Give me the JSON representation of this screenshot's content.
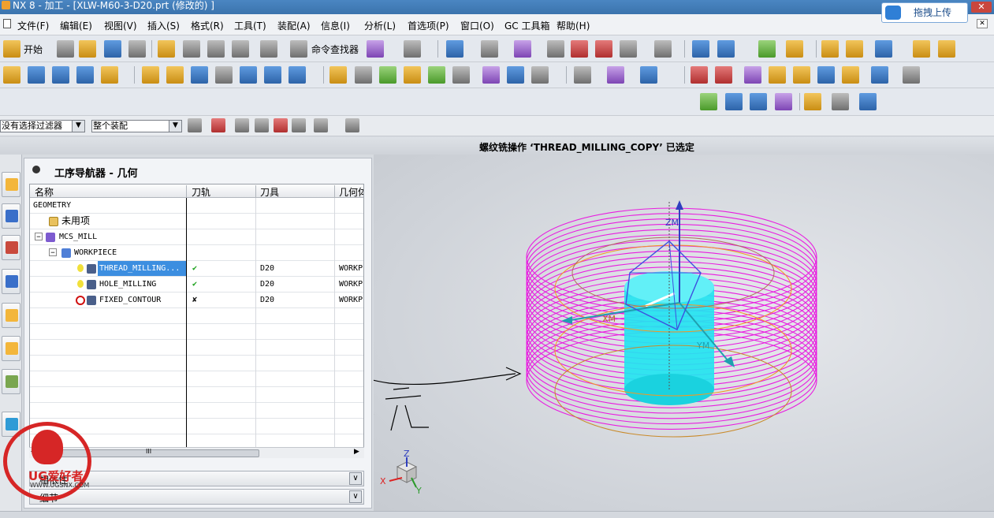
{
  "window": {
    "title": "NX 8 - 加工 - [XLW-M60-3-D20.prt (修改的) ]",
    "upload_button": "拖拽上传",
    "close_glyph": "✕"
  },
  "menubar": {
    "items": [
      "文件(F)",
      "编辑(E)",
      "视图(V)",
      "插入(S)",
      "格式(R)",
      "工具(T)",
      "装配(A)",
      "信息(I)",
      "分析(L)",
      "首选项(P)",
      "窗口(O)",
      "GC 工具箱",
      "帮助(H)"
    ]
  },
  "toolbar": {
    "start_label": "开始",
    "command_finder_label": "命令查找器"
  },
  "filters": {
    "selection_filter": "没有选择过滤器",
    "assembly_scope": "整个装配"
  },
  "status": {
    "message": "螺纹铣操作 ‘THREAD_MILLING_COPY’ 已选定"
  },
  "navigator": {
    "title": "工序导航器 - 几何",
    "columns": [
      "名称",
      "刀轨",
      "刀具",
      "几何体"
    ],
    "rows": [
      {
        "name": "GEOMETRY",
        "path": "",
        "tool": "",
        "geometry": ""
      },
      {
        "name": "未用项",
        "path": "",
        "tool": "",
        "geometry": ""
      },
      {
        "name": "MCS_MILL",
        "path": "",
        "tool": "",
        "geometry": ""
      },
      {
        "name": "WORKPIECE",
        "path": "",
        "tool": "",
        "geometry": ""
      },
      {
        "name": "THREAD_MILLING...",
        "path": "✔",
        "tool": "D20",
        "geometry": "WORKPI"
      },
      {
        "name": "HOLE_MILLING",
        "path": "✔",
        "tool": "D20",
        "geometry": "WORKPI"
      },
      {
        "name": "FIXED_CONTOUR",
        "path": "✘",
        "tool": "D20",
        "geometry": "WORKPI"
      }
    ],
    "scroll_marker": "III",
    "panels": [
      "相依性",
      "细节"
    ]
  },
  "viewport": {
    "mcs_labels": [
      "ZM",
      "XM",
      "YM"
    ],
    "triad_labels": [
      "Z",
      "X",
      "Y"
    ]
  },
  "logo": {
    "brand": "UG爱好者",
    "url": "WWW.UGSNX.COM"
  },
  "colors": {
    "toolpath": "#e81ee0",
    "tool": "#23e4f0",
    "selection": "#3c8ee0",
    "annotation": "#000000"
  }
}
